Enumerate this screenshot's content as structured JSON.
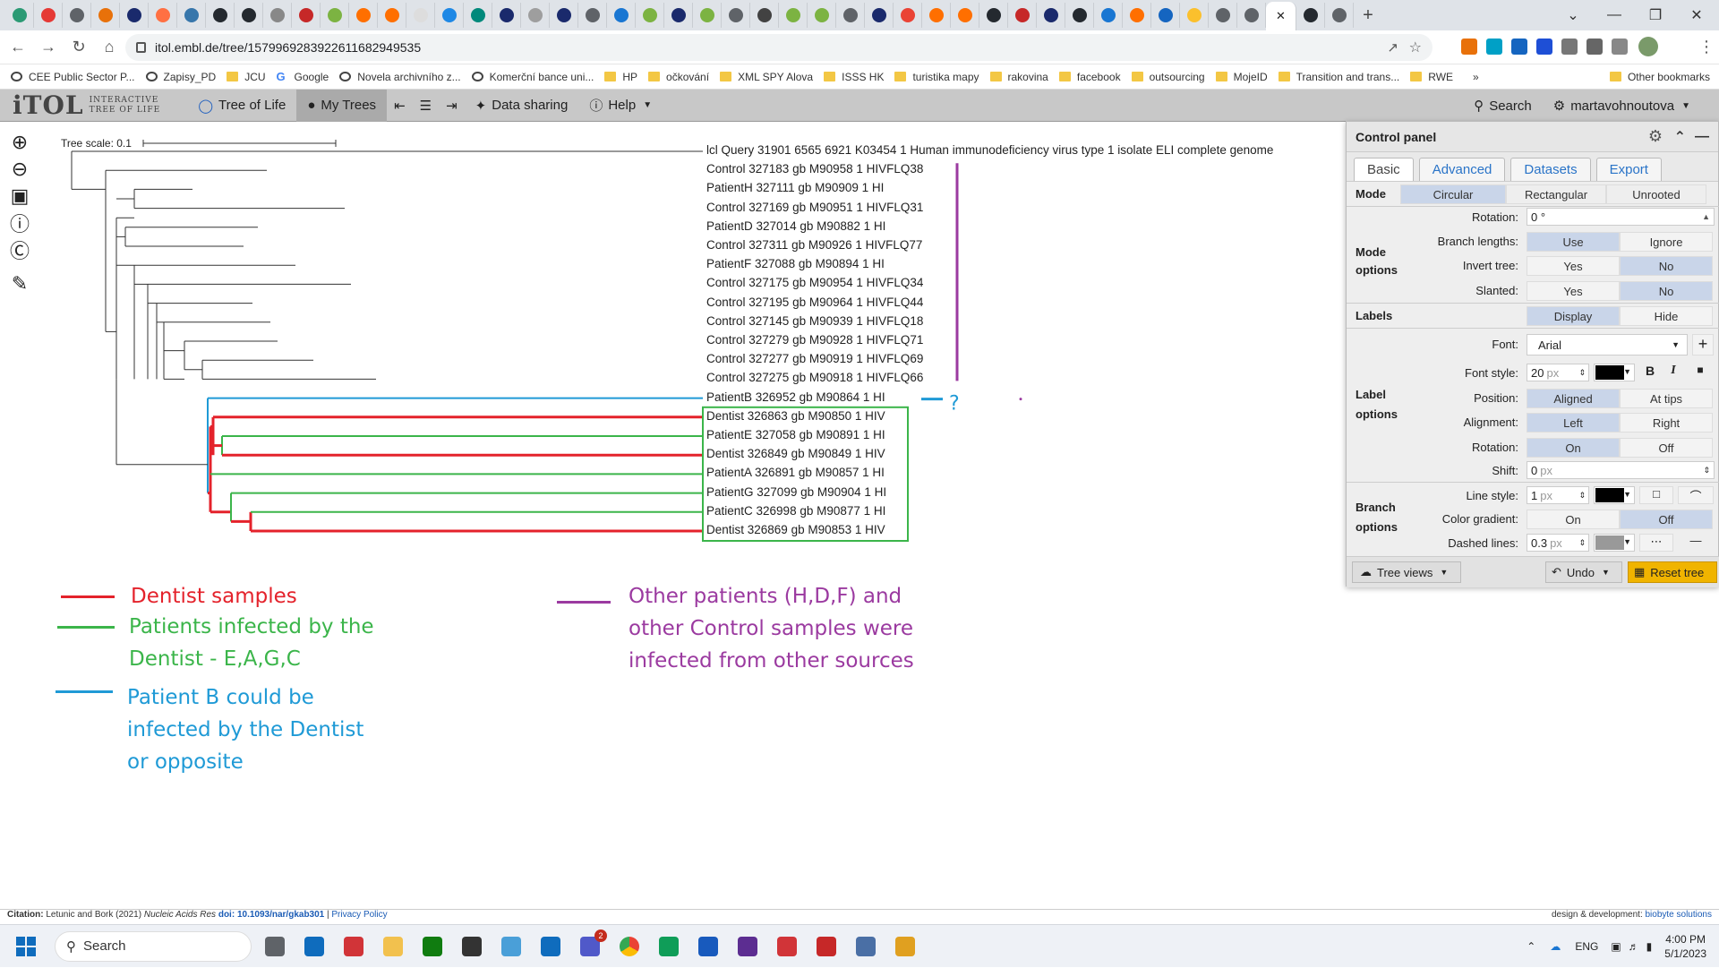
{
  "browser": {
    "url": "itol.embl.de/tree/1579969283922611682949535",
    "tab_colors": [
      "#2b9a74",
      "#e53935",
      "#5f6368",
      "#e8710a",
      "#1a2a6c",
      "#ff7043",
      "#3776ab",
      "#24292f",
      "#24292f",
      "#888888",
      "#c62828",
      "#7cb342",
      "#ff6f00",
      "#ff6f00",
      "#dddddd",
      "#1e88e5",
      "#00897b",
      "#1a2a6c",
      "#9e9e9e",
      "#1a2a6c",
      "#5f6368",
      "#1976d2",
      "#7cb342",
      "#1a2a6c",
      "#7cb342",
      "#5f6368",
      "#424242",
      "#7cb342",
      "#7cb342",
      "#5f6368",
      "#1a2a6c",
      "#ea4335",
      "#ff6f00",
      "#ff6f00",
      "#24292f",
      "#c62828",
      "#1a2a6c",
      "#24292f",
      "#1976d2",
      "#ff6f00",
      "#1565c0",
      "#fbc02d",
      "#5f6368",
      "#5f6368",
      "#ffffff",
      "#24292f",
      "#5f6368"
    ],
    "window_controls": [
      "⌄",
      "—",
      "❐",
      "✕"
    ]
  },
  "bookmarks": [
    {
      "label": "CEE Public Sector P...",
      "icon": "globe"
    },
    {
      "label": "Zapisy_PD",
      "icon": "globe"
    },
    {
      "label": "JCU",
      "icon": "folder"
    },
    {
      "label": "Google",
      "icon": "google"
    },
    {
      "label": "Novela archivního z...",
      "icon": "globe"
    },
    {
      "label": "Komerční bance uni...",
      "icon": "globe"
    },
    {
      "label": "HP",
      "icon": "folder"
    },
    {
      "label": "očkování",
      "icon": "folder"
    },
    {
      "label": "XML SPY Alova",
      "icon": "folder"
    },
    {
      "label": "ISSS HK",
      "icon": "folder"
    },
    {
      "label": "turistika mapy",
      "icon": "folder"
    },
    {
      "label": "rakovina",
      "icon": "folder"
    },
    {
      "label": "facebook",
      "icon": "folder"
    },
    {
      "label": "outsourcing",
      "icon": "folder"
    },
    {
      "label": "MojeID",
      "icon": "folder"
    },
    {
      "label": "Transition and trans...",
      "icon": "folder"
    },
    {
      "label": "RWE",
      "icon": "folder"
    }
  ],
  "bookmarks_more": "»",
  "other_bookmarks": "Other bookmarks",
  "itol": {
    "logo_big": "iTOL",
    "logo_small_1": "INTERACTIVE",
    "logo_small_2": "TREE OF LIFE",
    "menu": {
      "tree_of_life": "Tree of Life",
      "my_trees": "My Trees",
      "data_sharing": "Data sharing",
      "help": "Help"
    },
    "search": "Search",
    "user": "martavohnoutova"
  },
  "tree": {
    "scale_label": "Tree scale: 0.1",
    "labels": [
      "lcl Query 31901 6565 6921 K03454 1 Human immunodeficiency virus type 1  isolate ELI  complete genome",
      "Control 327183 gb M90958 1 HIVFLQ38",
      "PatientH 327111 gb M90909 1 HI",
      "Control 327169 gb M90951 1 HIVFLQ31",
      "PatientD 327014 gb M90882 1 HI",
      "Control 327311 gb M90926 1 HIVFLQ77",
      "PatientF 327088 gb M90894 1 HI",
      "Control 327175 gb M90954 1 HIVFLQ34",
      "Control 327195 gb M90964 1 HIVFLQ44",
      "Control 327145 gb M90939 1 HIVFLQ18",
      "Control 327279 gb M90928 1 HIVFLQ71",
      "Control 327277 gb M90919 1 HIVFLQ69",
      "Control 327275 gb M90918 1 HIVFLQ66",
      "PatientB 326952 gb M90864 1 HI",
      "Dentist 326863 gb M90850 1 HIV",
      "PatientE 327058 gb M90891 1 HI",
      "Dentist 326849 gb M90849 1 HIV",
      "PatientA 326891 gb M90857 1 HI",
      "PatientG 327099 gb M90904 1 HI",
      "PatientC 326998 gb M90877 1 HI",
      "Dentist 326869 gb M90853 1 HIV"
    ],
    "question_mark": "?",
    "colors": {
      "red": "#e4222b",
      "green": "#3bb54a",
      "blue": "#1f9ad6",
      "purple": "#9b3aa0",
      "black": "#333333"
    }
  },
  "legend": {
    "dentist": "Dentist samples",
    "infected": [
      "Patients infected by the",
      "Dentist - E,A,G,C"
    ],
    "patient_b": [
      "Patient B could be",
      "infected by the Dentist",
      "or opposite"
    ],
    "other": [
      "Other patients (H,D,F) and",
      "other Control samples were",
      "infected from other sources"
    ]
  },
  "control_panel": {
    "title": "Control panel",
    "tabs": [
      "Basic",
      "Advanced",
      "Datasets",
      "Export"
    ],
    "mode_label": "Mode",
    "modes": [
      "Circular",
      "Rectangular",
      "Unrooted"
    ],
    "mode_options_label": [
      "Mode",
      "options"
    ],
    "rotation_label": "Rotation:",
    "rotation_value": "0 °",
    "branch_lengths_label": "Branch lengths:",
    "branch_lengths": [
      "Use",
      "Ignore"
    ],
    "invert_label": "Invert tree:",
    "slanted_label": "Slanted:",
    "yes": "Yes",
    "no": "No",
    "labels_label": "Labels",
    "labels_opts": [
      "Display",
      "Hide"
    ],
    "label_options_label": [
      "Label",
      "options"
    ],
    "font_label": "Font:",
    "font_value": "Arial",
    "font_style_label": "Font style:",
    "font_size": "20",
    "px": "px",
    "position_label": "Position:",
    "position_opts": [
      "Aligned",
      "At tips"
    ],
    "alignment_label": "Alignment:",
    "alignment_opts": [
      "Left",
      "Right"
    ],
    "label_rotation_label": "Rotation:",
    "on": "On",
    "off": "Off",
    "shift_label": "Shift:",
    "shift_value": "0",
    "branch_options_label": [
      "Branch",
      "options"
    ],
    "line_style_label": "Line style:",
    "line_size": "1",
    "gradient_label": "Color gradient:",
    "dashed_label": "Dashed lines:",
    "dashed_value": "0.3",
    "tree_views": "Tree views",
    "undo": "Undo",
    "reset": "Reset tree"
  },
  "footer": {
    "citation_label": "Citation:",
    "citation": " Letunic and Bork (2021) ",
    "journal": "Nucleic Acids Res",
    "doi": " doi: 10.1093/nar/gkab301",
    "privacy": "Privacy Policy",
    "design": "design & development: ",
    "company": "biobyte solutions"
  },
  "taskbar": {
    "search": "Search",
    "app_colors": [
      "#5f6368",
      "#0f6cbd",
      "#d13438",
      "#f2c14e",
      "#107c10",
      "#333333",
      "#4a9fd8",
      "#0f6cbd",
      "#5059c9",
      "#34a853",
      "#0f9d58",
      "#185abd",
      "#5c2d91",
      "#d13438",
      "#c62828",
      "#4a6fa5",
      "#e0a020"
    ],
    "teams_badge": "2",
    "lang": "ENG",
    "time": "4:00 PM",
    "date": "5/1/2023"
  }
}
